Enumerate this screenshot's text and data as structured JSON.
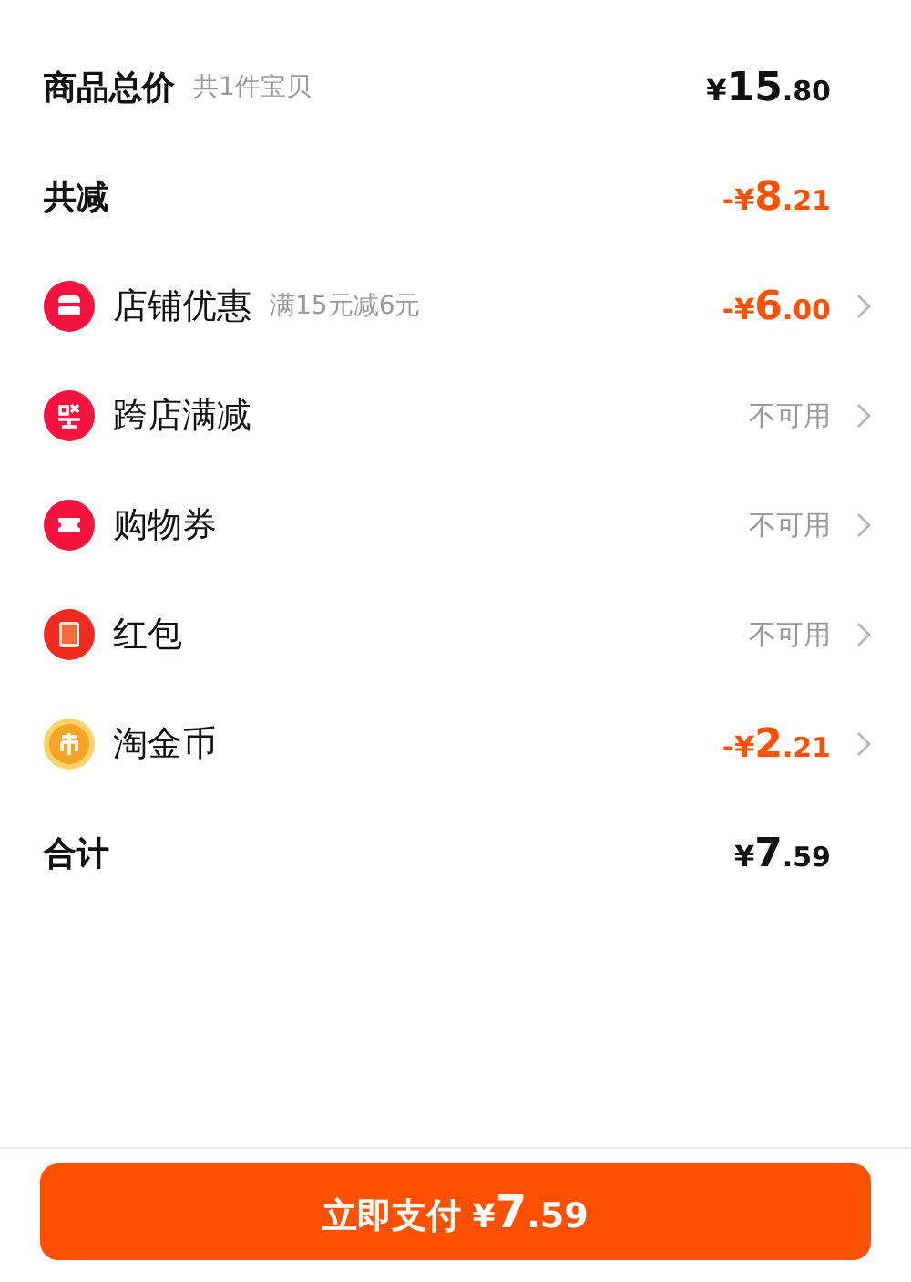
{
  "rows": [
    {
      "kind": "summary",
      "label": "商品总价",
      "note": "共1件宝贝",
      "amount": {
        "prefix": "¥",
        "int": "15",
        "dec": ".80",
        "highlight": false
      },
      "arrow": false
    },
    {
      "kind": "summary",
      "label": "共减",
      "amount": {
        "prefix": "-¥",
        "int": "8",
        "dec": ".21",
        "highlight": true
      },
      "arrow": false
    },
    {
      "kind": "option",
      "label": "店铺优惠",
      "note": "满15元减6元",
      "amount": {
        "prefix": "-¥",
        "int": "6",
        "dec": ".00",
        "highlight": true
      },
      "arrow": true
    },
    {
      "kind": "option",
      "label": "跨店满减",
      "status": "不可用",
      "arrow": true
    },
    {
      "kind": "option",
      "label": "购物券",
      "status": "不可用",
      "arrow": true
    },
    {
      "kind": "option",
      "label": "红包",
      "status": "不可用",
      "arrow": true
    },
    {
      "kind": "option",
      "label": "淘金币",
      "amount": {
        "prefix": "-¥",
        "int": "2",
        "dec": ".21",
        "highlight": true
      },
      "arrow": true
    },
    {
      "kind": "summary",
      "label": "合计",
      "amount": {
        "prefix": "¥",
        "int": "7",
        "dec": ".59",
        "highlight": false
      },
      "arrow": false
    }
  ],
  "pay_button": {
    "label": "立即支付",
    "amount": {
      "prefix": "¥",
      "int": "7",
      "dec": ".59"
    }
  }
}
